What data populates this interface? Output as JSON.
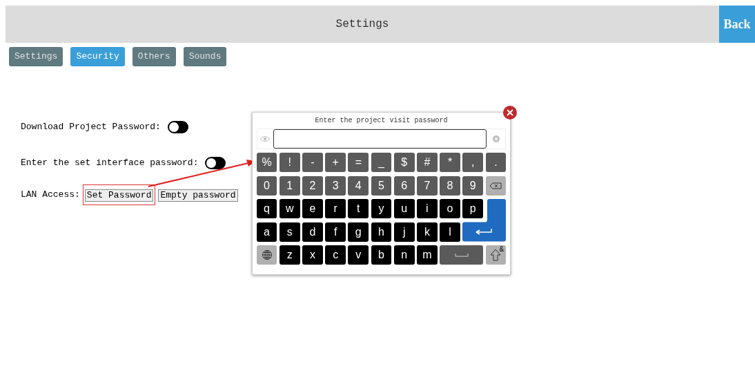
{
  "header": {
    "title": "Settings",
    "back_button": "Back"
  },
  "tabs": [
    {
      "label": "Settings",
      "selected": false
    },
    {
      "label": "Security",
      "selected": true
    },
    {
      "label": "Others",
      "selected": false
    },
    {
      "label": "Sounds",
      "selected": false
    }
  ],
  "settings": [
    {
      "kind": "toggle",
      "label": "Download Project Password:",
      "on": false
    },
    {
      "kind": "toggle",
      "label": "Enter the set interface password:",
      "on": false
    },
    {
      "kind": "buttons",
      "label": "LAN Access:",
      "buttons": [
        {
          "label": "Set Password",
          "highlighted": true
        },
        {
          "label": "Empty password",
          "highlighted": false
        }
      ]
    }
  ],
  "keyboard_dialog": {
    "title": "Enter the project visit password",
    "rows": [
      [
        {
          "kind": "symbol",
          "label": "%"
        },
        {
          "kind": "symbol",
          "label": "!"
        },
        {
          "kind": "symbol",
          "label": "-"
        },
        {
          "kind": "symbol",
          "label": "+"
        },
        {
          "kind": "symbol",
          "label": "="
        },
        {
          "kind": "symbol",
          "label": "_"
        },
        {
          "kind": "symbol",
          "label": "$"
        },
        {
          "kind": "symbol",
          "label": "#"
        },
        {
          "kind": "symbol",
          "label": "*"
        },
        {
          "kind": "symbol",
          "label": ","
        },
        {
          "kind": "symbol",
          "label": "."
        }
      ],
      [
        {
          "kind": "symbol",
          "label": "0"
        },
        {
          "kind": "symbol",
          "label": "1"
        },
        {
          "kind": "symbol",
          "label": "2"
        },
        {
          "kind": "symbol",
          "label": "3"
        },
        {
          "kind": "symbol",
          "label": "4"
        },
        {
          "kind": "symbol",
          "label": "5"
        },
        {
          "kind": "symbol",
          "label": "6"
        },
        {
          "kind": "symbol",
          "label": "7"
        },
        {
          "kind": "symbol",
          "label": "8"
        },
        {
          "kind": "symbol",
          "label": "9"
        },
        {
          "kind": "backspace"
        }
      ],
      [
        {
          "kind": "letter",
          "label": "q"
        },
        {
          "kind": "letter",
          "label": "w"
        },
        {
          "kind": "letter",
          "label": "e"
        },
        {
          "kind": "letter",
          "label": "r"
        },
        {
          "kind": "letter",
          "label": "t"
        },
        {
          "kind": "letter",
          "label": "y"
        },
        {
          "kind": "letter",
          "label": "u"
        },
        {
          "kind": "letter",
          "label": "i"
        },
        {
          "kind": "letter",
          "label": "o"
        },
        {
          "kind": "letter",
          "label": "p"
        },
        {
          "kind": "enter"
        }
      ],
      [
        {
          "kind": "letter",
          "label": "a"
        },
        {
          "kind": "letter",
          "label": "s"
        },
        {
          "kind": "letter",
          "label": "d"
        },
        {
          "kind": "letter",
          "label": "f"
        },
        {
          "kind": "letter",
          "label": "g"
        },
        {
          "kind": "letter",
          "label": "h"
        },
        {
          "kind": "letter",
          "label": "j"
        },
        {
          "kind": "letter",
          "label": "k"
        },
        {
          "kind": "letter",
          "label": "l"
        }
      ],
      [
        {
          "kind": "globe"
        },
        {
          "kind": "letter",
          "label": "z"
        },
        {
          "kind": "letter",
          "label": "x"
        },
        {
          "kind": "letter",
          "label": "c"
        },
        {
          "kind": "letter",
          "label": "v"
        },
        {
          "kind": "letter",
          "label": "b"
        },
        {
          "kind": "letter",
          "label": "n"
        },
        {
          "kind": "letter",
          "label": "m"
        },
        {
          "kind": "space"
        },
        {
          "kind": "shift",
          "label": "&"
        }
      ]
    ]
  }
}
